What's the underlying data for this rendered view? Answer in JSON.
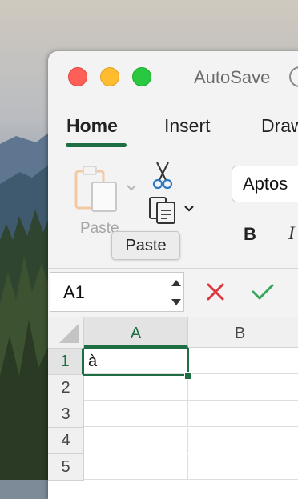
{
  "window": {
    "autosave_label": "AutoSave"
  },
  "tabs": [
    {
      "label": "Home",
      "active": true
    },
    {
      "label": "Insert"
    },
    {
      "label": "Draw"
    }
  ],
  "ribbon": {
    "paste_label": "Paste",
    "font_name": "Aptos",
    "bold_label": "B",
    "italic_label": "I"
  },
  "tooltip": {
    "text": "Paste"
  },
  "formula_bar": {
    "name_box_value": "A1"
  },
  "grid": {
    "columns": [
      "A",
      "B"
    ],
    "rows": [
      "1",
      "2",
      "3",
      "4",
      "5"
    ],
    "cells": {
      "A1": "à"
    },
    "active_cell": "A1"
  },
  "colors": {
    "accent": "#1f6e43",
    "close": "#fe5f57",
    "minimize": "#febc2e",
    "maximize": "#28c840",
    "cancel": "#d9363e",
    "enter": "#3aa55d"
  }
}
